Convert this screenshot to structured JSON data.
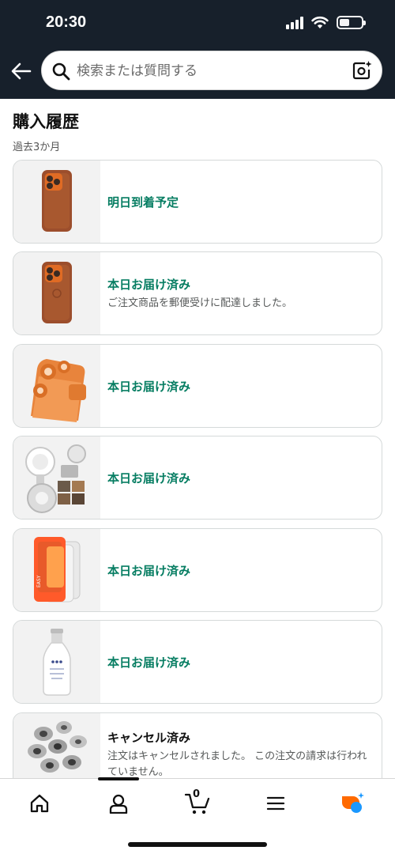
{
  "status_bar": {
    "time": "20:30"
  },
  "search": {
    "placeholder": "検索または質問する"
  },
  "page": {
    "title": "購入履歴",
    "period": "過去3か月"
  },
  "orders": [
    {
      "status": "明日到着予定",
      "detail": "",
      "product": "orange-phone-case"
    },
    {
      "status": "本日お届け済み",
      "detail": "ご注文商品を郵便受けに配達しました。",
      "product": "orange-phone-case"
    },
    {
      "status": "本日お届け済み",
      "detail": "",
      "product": "orange-camera-lens-cover"
    },
    {
      "status": "本日お届け済み",
      "detail": "",
      "product": "magnetic-ring-stand"
    },
    {
      "status": "本日お届け済み",
      "detail": "",
      "product": "screen-protector-kit"
    },
    {
      "status": "本日お届け済み",
      "detail": "",
      "product": "club-soda-bottle"
    },
    {
      "status": "キャンセル済み",
      "detail": "注文はキャンセルされました。 この注文の請求は行われていません。",
      "product": "earbud-ear-tips"
    }
  ],
  "bottom_nav": {
    "cart_count": "0",
    "items": [
      "home-icon",
      "account-icon",
      "cart-icon",
      "menu-icon",
      "assistant-icon"
    ]
  },
  "colors": {
    "header": "#17202b",
    "delivered": "#067d62",
    "assistant_orange": "#ff6a00",
    "assistant_blue": "#1a98ff"
  }
}
